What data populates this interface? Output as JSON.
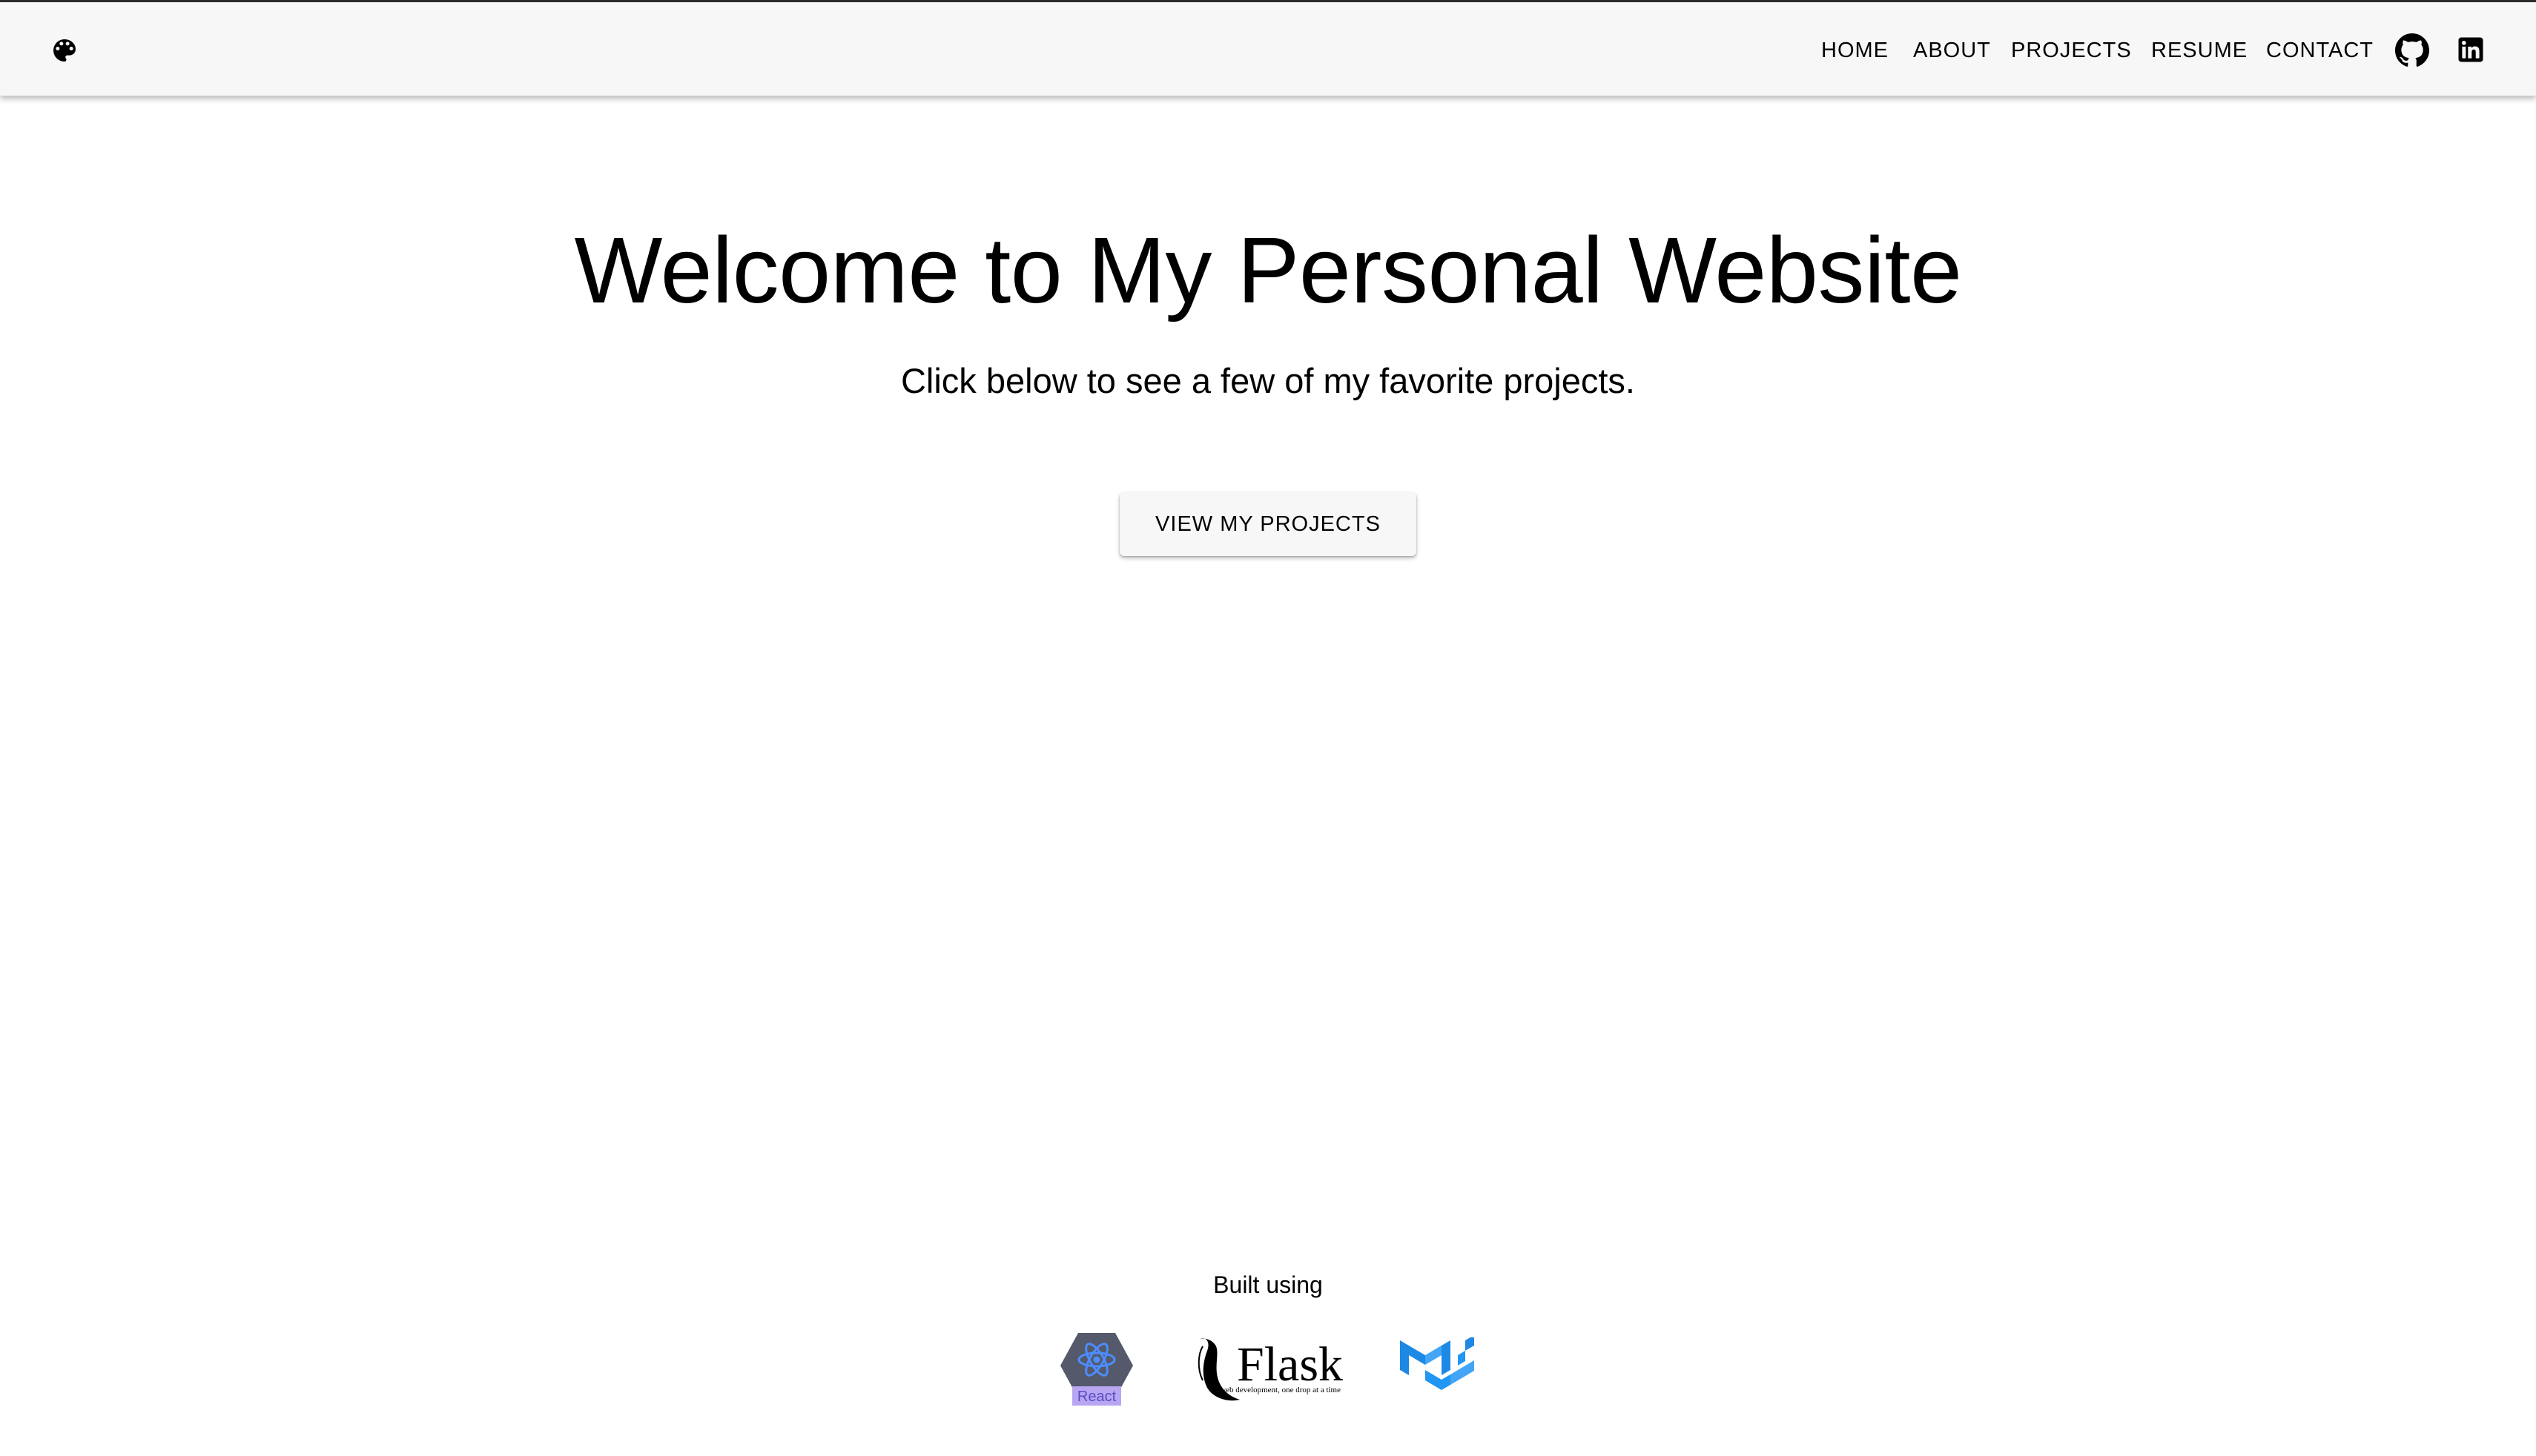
{
  "navbar": {
    "theme_icon": "palette-icon",
    "links": [
      "HOME",
      "ABOUT",
      "PROJECTS",
      "RESUME",
      "CONTACT"
    ],
    "social_icons": [
      "github-icon",
      "linkedin-icon"
    ]
  },
  "hero": {
    "title": "Welcome to My Personal Website",
    "subtitle": "Click below to see a few of my favorite projects.",
    "cta_label": "VIEW MY PROJECTS"
  },
  "footer": {
    "label": "Built using",
    "logos": [
      {
        "icon": "react-logo-icon",
        "text": "React",
        "color": "#61dafb"
      },
      {
        "icon": "flask-logo-icon",
        "text": "Flask",
        "tagline": "web development, one drop at a time"
      },
      {
        "icon": "material-ui-logo-icon",
        "color": "#2196f3"
      }
    ]
  },
  "colors": {
    "navbar_bg": "#f7f7f7",
    "page_bg": "#ffffff",
    "text": "#000000",
    "mui_blue": "#2196f3"
  }
}
